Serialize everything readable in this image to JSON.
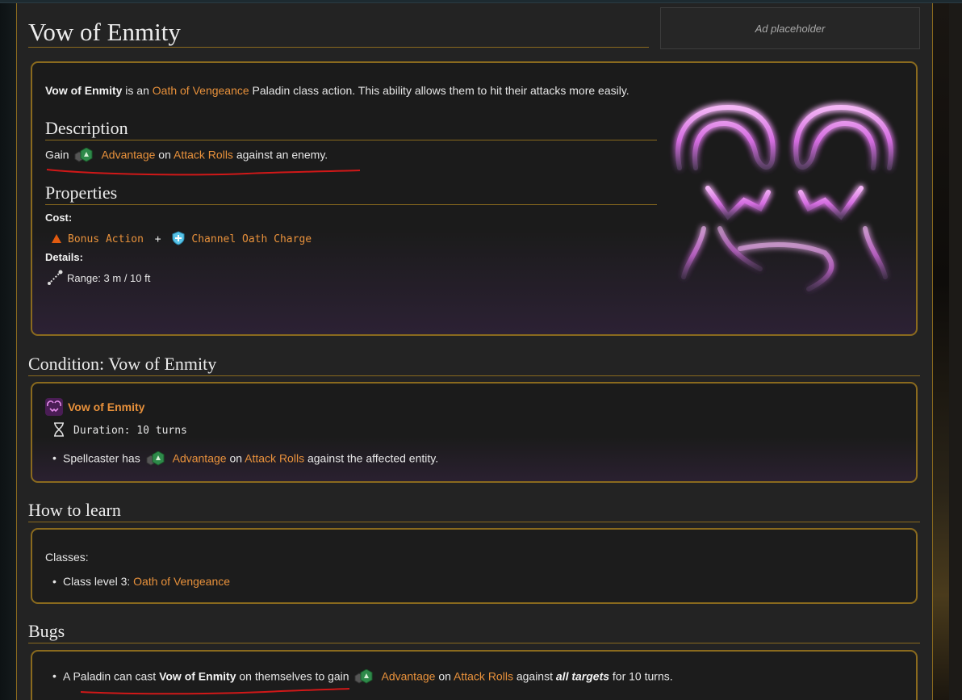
{
  "title": "Vow of Enmity",
  "ad": "Ad placeholder",
  "intro": {
    "bold": "Vow of Enmity",
    "t1": " is an ",
    "link": "Oath of Vengeance",
    "t2": " Paladin class action. This ability allows them to hit their attacks more easily."
  },
  "description": {
    "heading": "Description",
    "gain": "Gain",
    "advantage": "Advantage",
    "on": " on ",
    "attack_rolls": "Attack Rolls",
    "rest": " against an enemy."
  },
  "properties": {
    "heading": "Properties",
    "cost_label": "Cost:",
    "bonus_action": "Bonus Action",
    "plus": "+",
    "channel": "Channel Oath Charge",
    "details_label": "Details:",
    "range": "Range: 3 m / 10 ft"
  },
  "condition": {
    "heading": "Condition: Vow of Enmity",
    "name": "Vow of Enmity",
    "duration": "Duration: 10 turns",
    "spell_t1": "Spellcaster has",
    "advantage": "Advantage",
    "on": " on ",
    "attack_rolls": "Attack Rolls",
    "rest": " against the affected entity."
  },
  "how_to_learn": {
    "heading": "How to learn",
    "classes_label": "Classes:",
    "item_t1": "Class level 3: ",
    "item_link": "Oath of Vengeance"
  },
  "bugs": {
    "heading": "Bugs",
    "t1": "A Paladin can cast ",
    "bold": "Vow of Enmity",
    "t2": " on themselves to gain",
    "advantage": "Advantage",
    "on": " on ",
    "attack_rolls": "Attack Rolls",
    "t3": " against ",
    "all_targets": "all targets",
    "t4": " for 10 turns."
  },
  "colors": {
    "accent_border": "#8a6a1e",
    "link": "#e8913b",
    "glow": "#d46ce0",
    "annotation": "#d01818"
  }
}
